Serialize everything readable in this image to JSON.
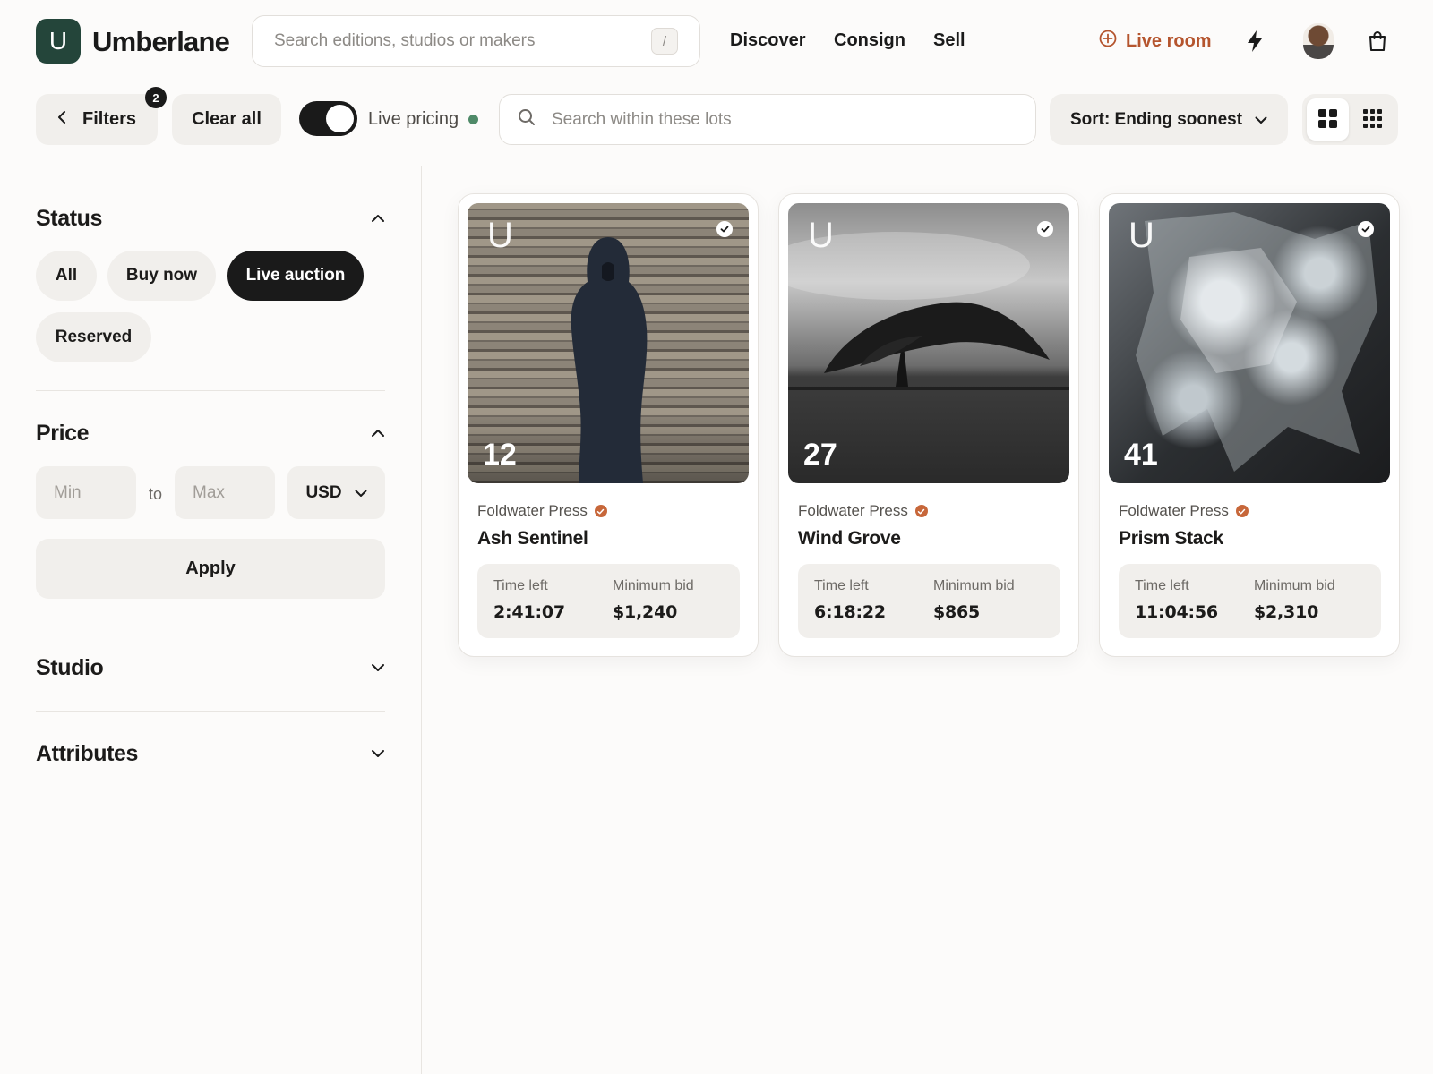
{
  "brand": {
    "logo_letter": "U",
    "name": "Umberlane",
    "color": "#24453a"
  },
  "header": {
    "search_placeholder": "Search editions, studios or makers",
    "search_shortcut": "/",
    "nav": [
      "Discover",
      "Consign",
      "Sell"
    ],
    "live_room": "Live room",
    "accent": "#b5552e",
    "icons": [
      "bolt-icon",
      "avatar",
      "shopping-bag-icon"
    ]
  },
  "toolbar": {
    "filters_label": "Filters",
    "filters_count": "2",
    "clear_all": "Clear all",
    "live_pricing_label": "Live pricing",
    "live_pricing_on": true,
    "lot_search_placeholder": "Search within these lots",
    "sort_label": "Sort: Ending soonest",
    "view_modes": [
      "large-grid",
      "small-grid"
    ],
    "active_view": "large-grid"
  },
  "sidebar": {
    "status": {
      "title": "Status",
      "options": [
        "All",
        "Buy now",
        "Live auction",
        "Reserved"
      ],
      "selected": "Live auction"
    },
    "price": {
      "title": "Price",
      "min_placeholder": "Min",
      "to_label": "to",
      "max_placeholder": "Max",
      "currency": "USD",
      "apply_label": "Apply"
    },
    "studio": {
      "title": "Studio"
    },
    "attributes": {
      "title": "Attributes"
    }
  },
  "lots": [
    {
      "edition": "12",
      "mark": "U",
      "studio": "Foldwater Press",
      "title": "Ash Sentinel",
      "time_left_label": "Time left",
      "time_left": "2:41:07",
      "min_bid_label": "Minimum bid",
      "min_bid": "$1,240"
    },
    {
      "edition": "27",
      "mark": "U",
      "studio": "Foldwater Press",
      "title": "Wind Grove",
      "time_left_label": "Time left",
      "time_left": "6:18:22",
      "min_bid_label": "Minimum bid",
      "min_bid": "$865"
    },
    {
      "edition": "41",
      "mark": "U",
      "studio": "Foldwater Press",
      "title": "Prism Stack",
      "time_left_label": "Time left",
      "time_left": "11:04:56",
      "min_bid_label": "Minimum bid",
      "min_bid": "$2,310"
    }
  ]
}
